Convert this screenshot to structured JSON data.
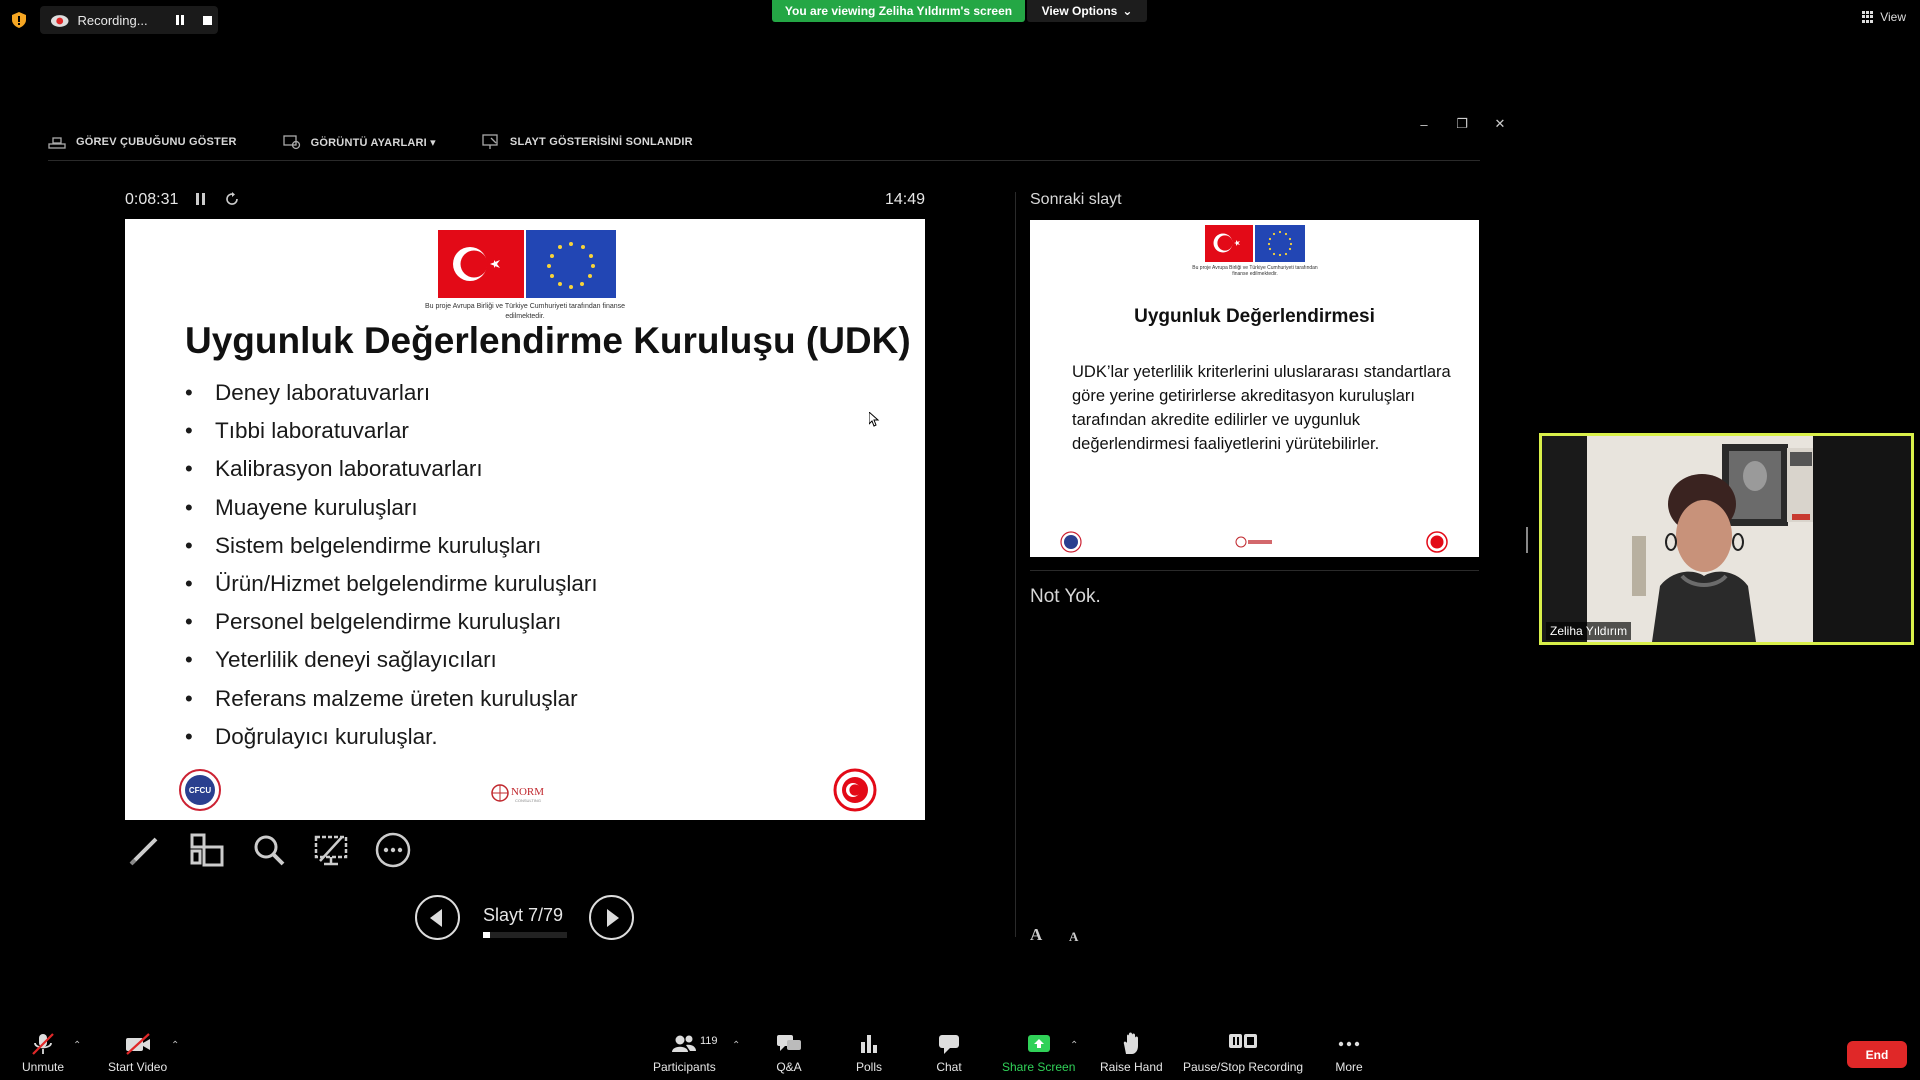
{
  "top": {
    "recording_label": "Recording...",
    "viewing_banner": "You are viewing Zeliha Yıldırım's screen",
    "view_options": "View Options",
    "view_label": "View"
  },
  "presenter_toolbar": {
    "show_taskbar": "GÖREV ÇUBUĞUNU GÖSTER",
    "display_settings": "GÖRÜNTÜ AYARLARI ▾",
    "end_slideshow": "SLAYT GÖSTERİSİNİ SONLANDIR"
  },
  "current": {
    "timer": "0:08:31",
    "clock": "14:49",
    "slide_counter": "Slayt 7/79",
    "progress": 0.0886
  },
  "slide": {
    "funding_caption": "Bu proje Avrupa Birliği ve Türkiye Cumhuriyeti tarafından finanse edilmektedir.",
    "title": "Uygunluk Değerlendirme Kuruluşu (UDK)",
    "bullets": [
      "Deney laboratuvarları",
      "Tıbbi laboratuvarlar",
      "Kalibrasyon laboratuvarları",
      "Muayene kuruluşları",
      "Sistem belgelendirme kuruluşları",
      "Ürün/Hizmet belgelendirme kuruluşları",
      "Personel belgelendirme kuruluşları",
      "Yeterlilik deneyi sağlayıcıları",
      "Referans malzeme üreten kuruluşlar",
      "Doğrulayıcı kuruluşlar."
    ],
    "logo_left": "CFCU",
    "logo_center": "NORM",
    "logo_center_sub": "CONSULTING"
  },
  "next": {
    "label": "Sonraki slayt",
    "title": "Uygunluk Değerlendirmesi",
    "body": "UDK’lar yeterlilik kriterlerini uluslararası standartlara göre yerine getirirlerse akreditasyon kuruluşları tarafından akredite edilirler ve uygunluk değerlendirmesi faaliyetlerini yürütebilirler.",
    "notes": "Not Yok.",
    "font_up": "A",
    "font_down": "A"
  },
  "video": {
    "name": "Zeliha Yıldırım"
  },
  "bottom": {
    "unmute": "Unmute",
    "start_video": "Start Video",
    "participants": "Participants",
    "participants_count": "119",
    "qa": "Q&A",
    "polls": "Polls",
    "chat": "Chat",
    "share_screen": "Share Screen",
    "raise_hand": "Raise Hand",
    "pause_stop_recording": "Pause/Stop Recording",
    "more": "More",
    "end": "End"
  },
  "colors": {
    "banner_green": "#24a745",
    "share_green": "#30d158",
    "end_red": "#e02828",
    "active_speaker_border": "#d9f04a"
  }
}
